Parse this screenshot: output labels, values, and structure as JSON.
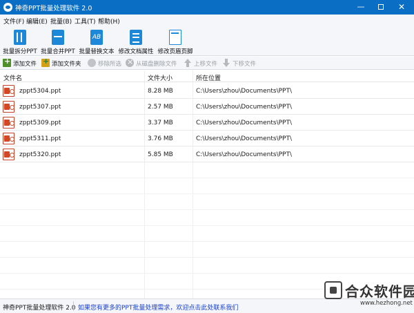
{
  "window": {
    "title": "神奇PPT批量处理软件 2.0",
    "controls": {
      "minimize": "—",
      "close": "✕"
    }
  },
  "menu": [
    "文件(F)",
    "编辑(E)",
    "批量(B)",
    "工具(T)",
    "帮助(H)"
  ],
  "ribbon": [
    {
      "label": "批量拆分PPT",
      "icon": "split-icon"
    },
    {
      "label": "批量合并PPT",
      "icon": "merge-icon"
    },
    {
      "label": "批量替换文本",
      "icon": "replace-text-icon",
      "glyph": "AB"
    },
    {
      "label": "修改文档属性",
      "icon": "document-properties-icon"
    },
    {
      "label": "修改页眉页脚",
      "icon": "header-footer-icon"
    }
  ],
  "toolbar": [
    {
      "label": "添加文件",
      "enabled": true
    },
    {
      "label": "添加文件夹",
      "enabled": true
    },
    {
      "label": "移除所选",
      "enabled": false
    },
    {
      "label": "从磁盘删除文件",
      "enabled": false
    },
    {
      "label": "上移文件",
      "enabled": false
    },
    {
      "label": "下移文件",
      "enabled": false
    }
  ],
  "columns": {
    "name": "文件名",
    "size": "文件大小",
    "location": "所在位置"
  },
  "files": [
    {
      "name": "zppt5304.ppt",
      "size": "8.28 MB",
      "location": "C:\\Users\\zhou\\Documents\\PPT\\"
    },
    {
      "name": "zppt5307.ppt",
      "size": "2.57 MB",
      "location": "C:\\Users\\zhou\\Documents\\PPT\\"
    },
    {
      "name": "zppt5309.ppt",
      "size": "3.37 MB",
      "location": "C:\\Users\\zhou\\Documents\\PPT\\"
    },
    {
      "name": "zppt5311.ppt",
      "size": "3.76 MB",
      "location": "C:\\Users\\zhou\\Documents\\PPT\\"
    },
    {
      "name": "zppt5320.ppt",
      "size": "5.85 MB",
      "location": "C:\\Users\\zhou\\Documents\\PPT\\"
    }
  ],
  "status": {
    "app": "神奇PPT批量处理软件 2.0",
    "message": "如果您有更多的PPT批量处理需求，欢迎点击此处联系我们"
  },
  "watermark": {
    "brand": "合众软件园",
    "url": "www.hezhong.net"
  },
  "colors": {
    "titlebar": "#0a6fc4",
    "accent": "#1e88d8",
    "link": "#1a3fd0",
    "ppt": "#d24726"
  }
}
